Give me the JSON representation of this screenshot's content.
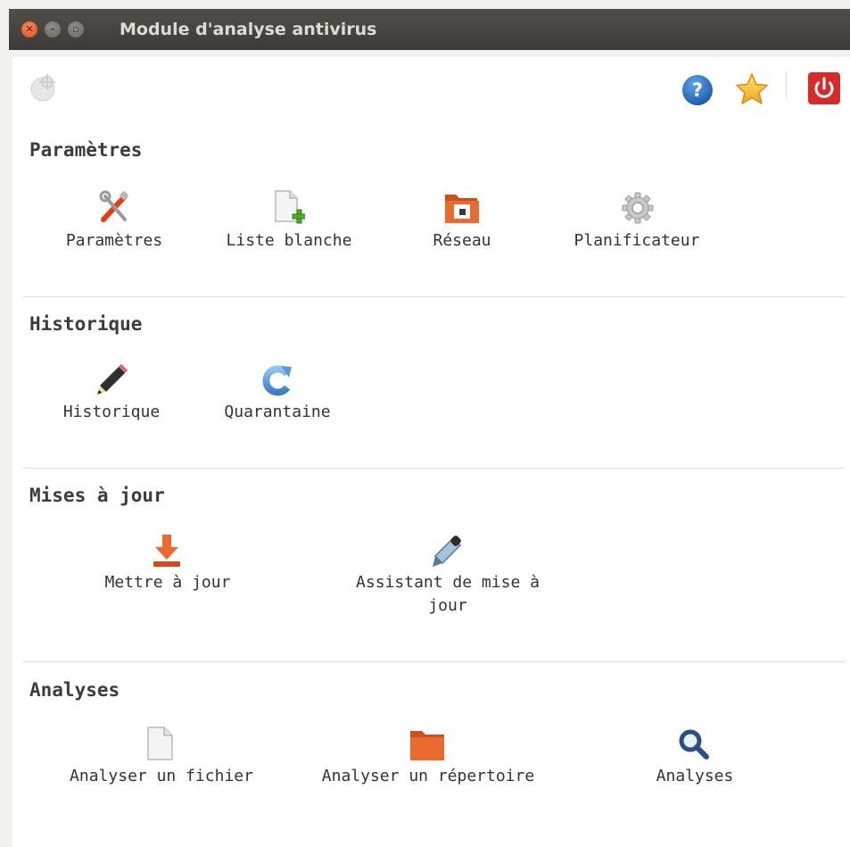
{
  "window": {
    "title": "Module d'analyse antivirus"
  },
  "toolbar": {
    "help_icon": "help-icon",
    "favorite_icon": "star-icon",
    "power_icon": "power-icon",
    "logo_icon": "crosshair-logo-icon"
  },
  "sections": {
    "parametres": {
      "title": "Paramètres",
      "items": [
        {
          "label": "Paramètres",
          "icon": "tools-icon"
        },
        {
          "label": "Liste blanche",
          "icon": "add-file-icon"
        },
        {
          "label": "Réseau",
          "icon": "network-folder-icon"
        },
        {
          "label": "Planificateur",
          "icon": "gear-icon"
        }
      ]
    },
    "historique": {
      "title": "Historique",
      "items": [
        {
          "label": "Historique",
          "icon": "pencil-icon"
        },
        {
          "label": "Quarantaine",
          "icon": "refresh-icon"
        }
      ]
    },
    "mises_a_jour": {
      "title": "Mises à jour",
      "items": [
        {
          "label": "Mettre à jour",
          "icon": "download-icon"
        },
        {
          "label": "Assistant de mise à jour",
          "icon": "dropper-icon"
        }
      ]
    },
    "analyses": {
      "title": "Analyses",
      "items": [
        {
          "label": "Analyser un fichier",
          "icon": "file-icon"
        },
        {
          "label": "Analyser un répertoire",
          "icon": "folder-icon"
        },
        {
          "label": "Analyses",
          "icon": "magnifier-icon"
        }
      ]
    }
  },
  "colors": {
    "titlebar": "#3c3b37",
    "close_button": "#df4a16",
    "accent_orange": "#e95420",
    "help_blue": "#2a76c6",
    "power_red": "#d52b2b"
  }
}
